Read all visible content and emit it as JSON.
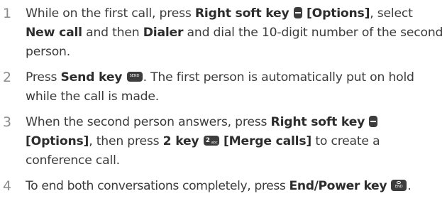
{
  "steps": [
    {
      "number": "1",
      "t1": "While on the first call, press ",
      "b1": "Right soft key",
      "b2": "[Options]",
      "t2": ", select",
      "b3": "New call",
      "t3": " and then ",
      "b4": "Dialer",
      "t4": " and dial the 10-digit number of the second person."
    },
    {
      "number": "2",
      "t1": "Press ",
      "b1": "Send key",
      "key_label": "SEND",
      "t2": ". The first person is automatically put on hold while the call is made."
    },
    {
      "number": "3",
      "t1": "When the second person answers, press ",
      "b1": "Right soft key",
      "b2": "[Options]",
      "t2": ", then press ",
      "b3": "2 key",
      "key_digit": "2",
      "key_letters": "abc",
      "b4": "[Merge calls]",
      "t3": " to create a conference call."
    },
    {
      "number": "4",
      "t1": "To end both conversations completely, press ",
      "b1": "End/Power key",
      "key_label": "END",
      "t2": "."
    }
  ],
  "icons": {
    "key_color": "#3d3d3d",
    "number_color": "#8a8a8a"
  }
}
